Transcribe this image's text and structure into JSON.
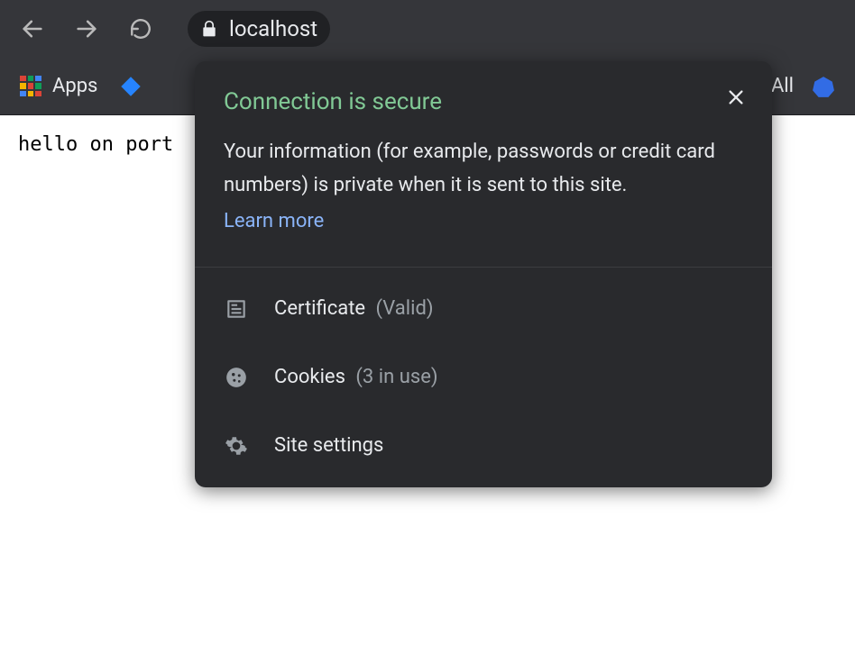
{
  "toolbar": {
    "url_display": "localhost"
  },
  "bookmarks": {
    "apps_label": "Apps",
    "right_label": "All"
  },
  "page": {
    "body_text": "hello on port"
  },
  "popover": {
    "title": "Connection is secure",
    "description": "Your information (for example, passwords or credit card numbers) is private when it is sent to this site.",
    "learn_more": "Learn more",
    "rows": [
      {
        "label": "Certificate",
        "status": "(Valid)"
      },
      {
        "label": "Cookies",
        "status": "(3 in use)"
      },
      {
        "label": "Site settings",
        "status": ""
      }
    ]
  }
}
